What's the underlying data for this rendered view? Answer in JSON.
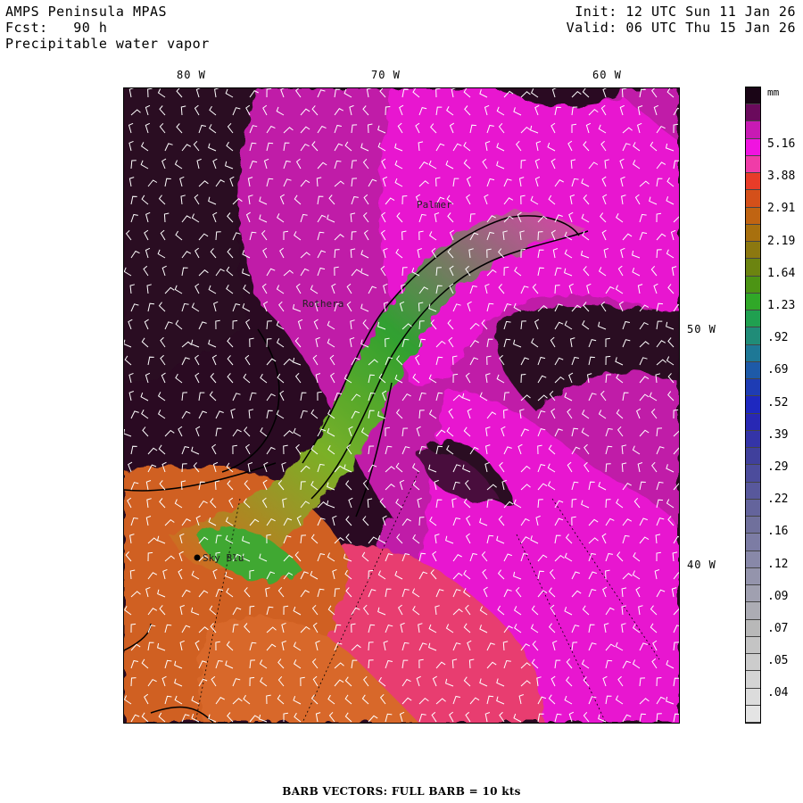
{
  "header": {
    "line1_left": "AMPS Peninsula MPAS",
    "line2_left": "Fcst:   90 h",
    "line3_left": "Precipitable water vapor",
    "line1_right": "Init: 12 UTC Sun 11 Jan 26",
    "line2_right": "Valid: 06 UTC Thu 15 Jan 26"
  },
  "longitude_labels": [
    "80 W",
    "70 W",
    "60 W"
  ],
  "latitude_labels": [
    "50 W",
    "40 W"
  ],
  "places": [
    "Palmer",
    "Rothera",
    "Sky Blu"
  ],
  "colorbar": {
    "unit": "mm",
    "labels": [
      "5.16",
      "3.88",
      "2.91",
      "2.19",
      "1.64",
      "1.23",
      ".92",
      ".69",
      ".52",
      ".39",
      ".29",
      ".22",
      ".16",
      ".12",
      ".09",
      ".07",
      ".05",
      ".04"
    ],
    "colors": [
      "#1a0516",
      "#6a0a5c",
      "#c81ab4",
      "#f014e0",
      "#f03ca8",
      "#e83c28",
      "#d4501a",
      "#c06412",
      "#a8700e",
      "#8c7810",
      "#6c8410",
      "#4c9414",
      "#30a828",
      "#20a050",
      "#208c78",
      "#1e7896",
      "#1e5aa8",
      "#1e3cb4",
      "#1e28c0",
      "#2828b4",
      "#3434a8",
      "#40409c",
      "#4c4c9c",
      "#58589c",
      "#64649c",
      "#70709c",
      "#7c7ca4",
      "#8888a8",
      "#9494ac",
      "#a0a0b0",
      "#acacb4",
      "#b8b8b8",
      "#c4c4c4",
      "#cccccc",
      "#d4d4d4",
      "#dcdcdc",
      "#e4e4e4"
    ]
  },
  "footer": "BARB VECTORS:  FULL BARB = 10 kts",
  "colors": {
    "deep": "#2a0a22",
    "magenta": "#e818d0",
    "pink": "#f040c0",
    "red": "#e04030",
    "orange": "#d06020",
    "green": "#30a030",
    "lime": "#7cb028"
  }
}
